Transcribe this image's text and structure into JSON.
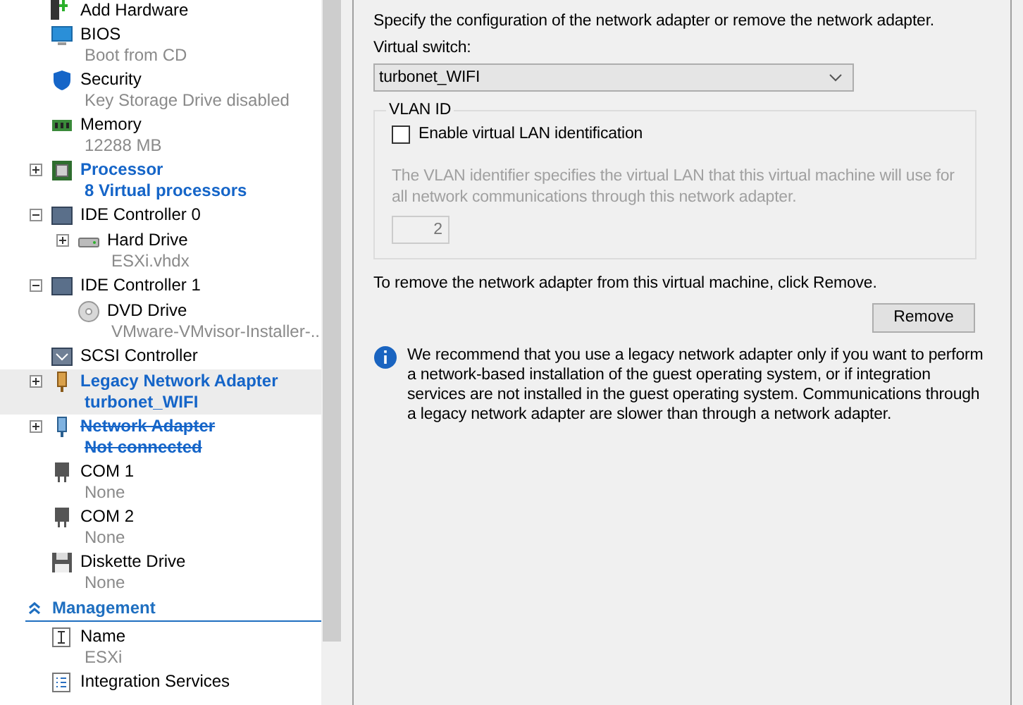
{
  "tree": [
    {
      "kind": "add-hardware",
      "title": "Add Hardware",
      "modified": false,
      "removed": false,
      "selected": false
    },
    {
      "kind": "bios",
      "title": "BIOS",
      "subtitle": "Boot from CD",
      "modified": false,
      "removed": false,
      "selected": false
    },
    {
      "kind": "security",
      "title": "Security",
      "subtitle": "Key Storage Drive disabled",
      "modified": false,
      "removed": false,
      "selected": false
    },
    {
      "kind": "memory",
      "title": "Memory",
      "subtitle": "12288 MB",
      "modified": false,
      "removed": false,
      "selected": false
    },
    {
      "kind": "processor",
      "title": "Processor",
      "subtitle": "8 Virtual processors",
      "modified": true,
      "removed": false,
      "selected": false,
      "expanded": false
    },
    {
      "kind": "controller",
      "title": "IDE Controller 0",
      "modified": false,
      "removed": false,
      "selected": false,
      "expanded": true,
      "children": [
        {
          "kind": "hard-drive",
          "title": "Hard Drive",
          "subtitle": "ESXi.vhdx",
          "modified": false,
          "removed": false,
          "selected": false,
          "expanded": false
        }
      ]
    },
    {
      "kind": "controller",
      "title": "IDE Controller 1",
      "modified": false,
      "removed": false,
      "selected": false,
      "expanded": true,
      "children": [
        {
          "kind": "dvd",
          "title": "DVD Drive",
          "subtitle": "VMware-VMvisor-Installer-...",
          "modified": false,
          "removed": false,
          "selected": false
        }
      ]
    },
    {
      "kind": "scsi",
      "title": "SCSI Controller",
      "modified": false,
      "removed": false,
      "selected": false
    },
    {
      "kind": "legacy-network",
      "title": "Legacy Network Adapter",
      "subtitle": "turbonet_WIFI",
      "modified": true,
      "removed": false,
      "selected": true,
      "expanded": false
    },
    {
      "kind": "network",
      "title": "Network Adapter",
      "subtitle": "Not connected",
      "modified": true,
      "removed": true,
      "selected": false,
      "expanded": false
    },
    {
      "kind": "com",
      "title": "COM 1",
      "subtitle": "None",
      "modified": false,
      "removed": false,
      "selected": false
    },
    {
      "kind": "com",
      "title": "COM 2",
      "subtitle": "None",
      "modified": false,
      "removed": false,
      "selected": false
    },
    {
      "kind": "diskette",
      "title": "Diskette Drive",
      "subtitle": "None",
      "modified": false,
      "removed": false,
      "selected": false
    },
    {
      "kind": "section",
      "title": "Management",
      "expanded": true
    },
    {
      "kind": "name",
      "title": "Name",
      "subtitle": "ESXi",
      "modified": false,
      "removed": false,
      "selected": false
    },
    {
      "kind": "integration",
      "title": "Integration Services",
      "modified": false,
      "removed": false,
      "selected": false
    }
  ],
  "details": {
    "intro": "Specify the configuration of the network adapter or remove the network adapter.",
    "switch_label": "Virtual switch:",
    "switch_value": "turbonet_WIFI",
    "vlan": {
      "title": "VLAN ID",
      "checkbox_label": "Enable virtual LAN identification",
      "checked": false,
      "description": "The VLAN identifier specifies the virtual LAN that this virtual machine will use for all network communications through this network adapter.",
      "value": "2",
      "disabled": true
    },
    "remove_text": "To remove the network adapter from this virtual machine, click Remove.",
    "remove_button": "Remove",
    "info": "We recommend that you use a legacy network adapter only if you want to perform a network-based installation of the guest operating system, or if integration services are not installed in the guest operating system. Communications through a legacy network adapter are slower than through a network adapter."
  }
}
